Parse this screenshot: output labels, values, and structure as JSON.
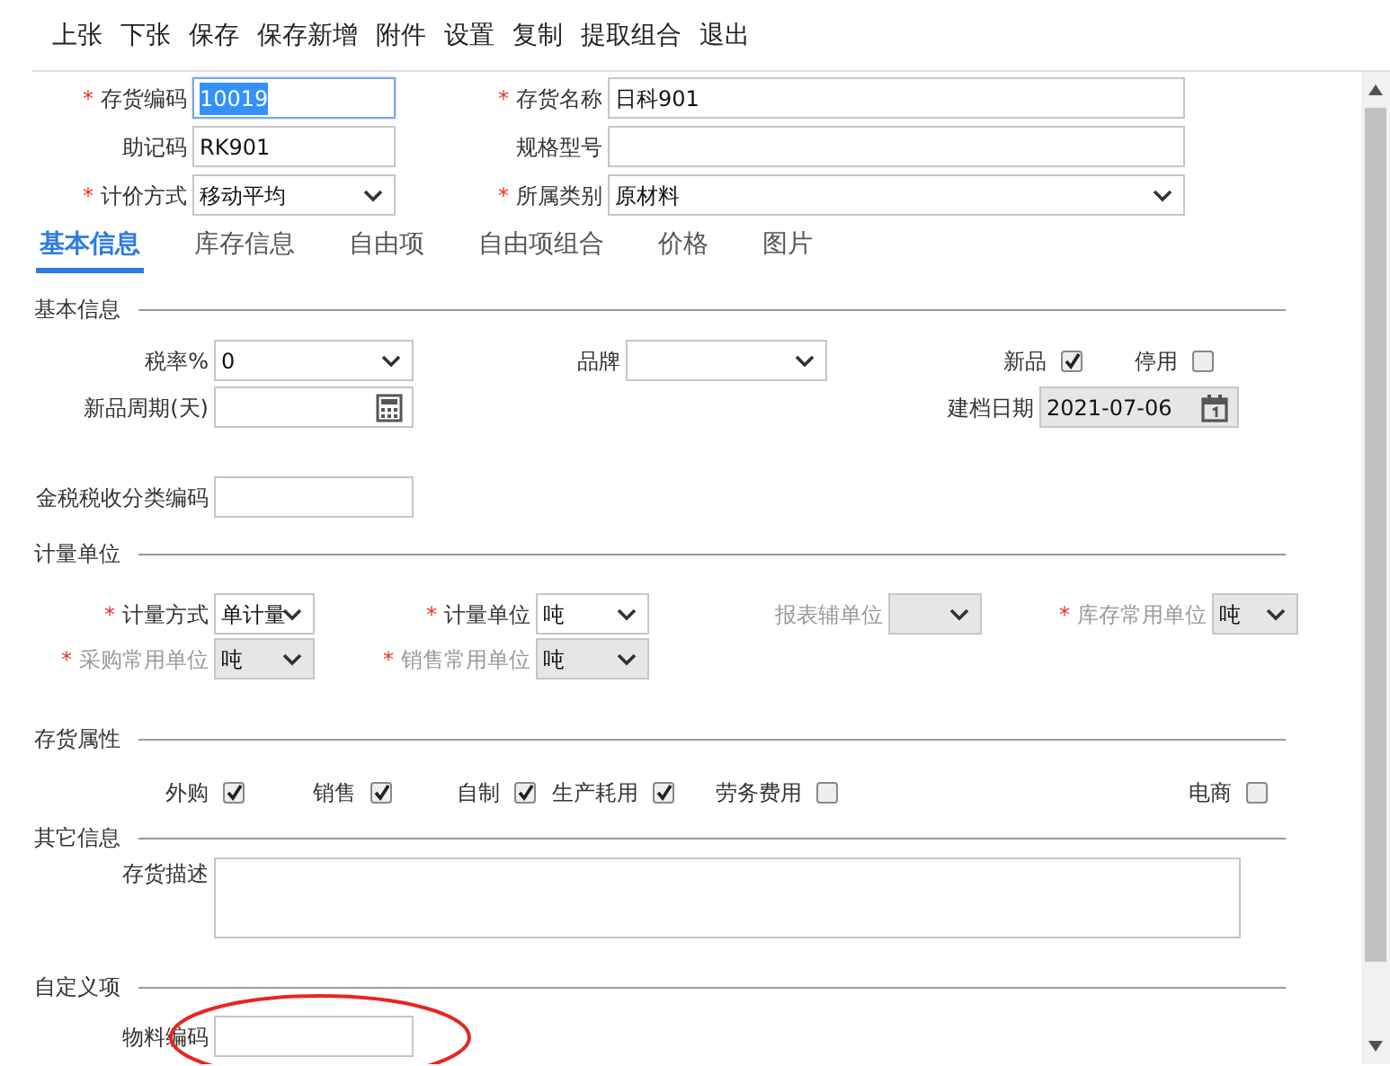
{
  "toolbar": [
    "上张",
    "下张",
    "保存",
    "保存新增",
    "附件",
    "设置",
    "复制",
    "提取组合",
    "退出"
  ],
  "header": [
    [
      {
        "mark": "*",
        "label": "存货编码",
        "kind": "text",
        "value": "10019",
        "focused": true
      },
      {
        "mark": "*",
        "label": "存货名称",
        "kind": "text",
        "value": "日科901"
      }
    ],
    [
      {
        "label": "助记码",
        "kind": "text",
        "value": "RK901"
      },
      {
        "label": "规格型号",
        "kind": "text"
      }
    ],
    [
      {
        "mark": "*",
        "label": "计价方式",
        "kind": "select",
        "value": "移动平均"
      },
      {
        "mark": "*",
        "label": "所属类别",
        "kind": "select",
        "value": "原材料"
      }
    ]
  ],
  "tabs": [
    {
      "label": "基本信息",
      "selected": true
    },
    {
      "label": "库存信息",
      "selected": false
    },
    {
      "label": "自由项",
      "selected": false
    },
    {
      "label": "自由项组合",
      "selected": false
    },
    {
      "label": "价格",
      "selected": false
    },
    {
      "label": "图片",
      "selected": false
    }
  ],
  "sections": [
    {
      "title": "基本信息",
      "rows": [
        [
          {
            "label": "税率%",
            "kind": "select",
            "value": "0"
          },
          {
            "label": "品牌",
            "kind": "select"
          },
          {
            "label": "新品",
            "kind": "checkbox",
            "checked": true
          },
          {
            "label": "停用",
            "kind": "checkbox",
            "checked": false
          }
        ],
        [
          {
            "label": "新品周期(天)",
            "kind": "calc"
          },
          "",
          {
            "label": "建档日期",
            "kind": "date",
            "value": "2021-07-06",
            "readonly": true
          }
        ],
        [
          {
            "label": "金税税收分类编码",
            "kind": "text"
          }
        ]
      ]
    },
    {
      "title": "计量单位",
      "rows": [
        [
          {
            "mark": "*",
            "label": "计量方式",
            "kind": "select",
            "value": "单计量"
          },
          {
            "mark": "*",
            "label": "计量单位",
            "kind": "select",
            "value": "吨"
          },
          {
            "label": "报表辅单位",
            "kind": "select",
            "disabled": true
          },
          {
            "mark": "*",
            "label": "库存常用单位",
            "kind": "select",
            "value": "吨",
            "disabled": true
          }
        ],
        [
          {
            "mark": "*",
            "label": "采购常用单位",
            "kind": "select",
            "value": "吨",
            "disabled": true
          },
          {
            "mark": "*",
            "label": "销售常用单位",
            "kind": "select",
            "value": "吨",
            "disabled": true
          }
        ]
      ]
    },
    {
      "title": "存货属性",
      "rows": [
        [
          {
            "label": "外购",
            "kind": "checkbox",
            "checked": true
          },
          {
            "label": "销售",
            "kind": "checkbox",
            "checked": true
          },
          {
            "label": "自制",
            "kind": "checkbox",
            "checked": true
          },
          {
            "label": "生产耗用",
            "kind": "checkbox",
            "checked": true
          },
          {
            "label": "劳务费用",
            "kind": "checkbox",
            "checked": false
          },
          {
            "label": "电商",
            "kind": "checkbox",
            "checked": false
          }
        ]
      ]
    },
    {
      "title": "其它信息",
      "rows": [
        [
          {
            "label": "存货描述",
            "kind": "textarea"
          }
        ]
      ]
    },
    {
      "title": "自定义项",
      "rows": [
        [
          {
            "label": "物料编码",
            "kind": "text"
          }
        ]
      ],
      "annotation": {
        "kind": "ellipse",
        "color": "#e8251f"
      }
    }
  ]
}
